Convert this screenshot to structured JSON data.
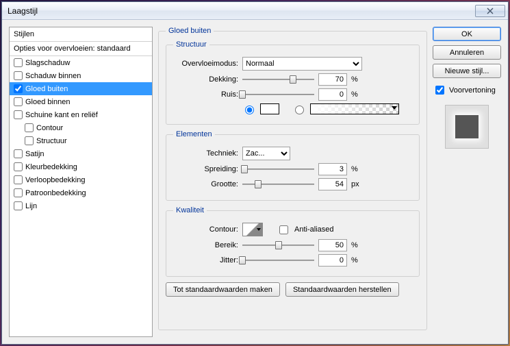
{
  "window": {
    "title": "Laagstijl"
  },
  "styles": {
    "header": "Stijlen",
    "blend": "Opties voor overvloeien: standaard",
    "items": [
      {
        "label": "Slagschaduw",
        "checked": false,
        "selected": false,
        "sub": false
      },
      {
        "label": "Schaduw binnen",
        "checked": false,
        "selected": false,
        "sub": false
      },
      {
        "label": "Gloed buiten",
        "checked": true,
        "selected": true,
        "sub": false
      },
      {
        "label": "Gloed binnen",
        "checked": false,
        "selected": false,
        "sub": false
      },
      {
        "label": "Schuine kant en reliëf",
        "checked": false,
        "selected": false,
        "sub": false
      },
      {
        "label": "Contour",
        "checked": false,
        "selected": false,
        "sub": true
      },
      {
        "label": "Structuur",
        "checked": false,
        "selected": false,
        "sub": true
      },
      {
        "label": "Satijn",
        "checked": false,
        "selected": false,
        "sub": false
      },
      {
        "label": "Kleurbedekking",
        "checked": false,
        "selected": false,
        "sub": false
      },
      {
        "label": "Verloopbedekking",
        "checked": false,
        "selected": false,
        "sub": false
      },
      {
        "label": "Patroonbedekking",
        "checked": false,
        "selected": false,
        "sub": false
      },
      {
        "label": "Lijn",
        "checked": false,
        "selected": false,
        "sub": false
      }
    ]
  },
  "panel": {
    "title": "Gloed buiten",
    "structure": {
      "legend": "Structuur",
      "blendmode_label": "Overvloeimodus:",
      "blendmode_value": "Normaal",
      "opacity_label": "Dekking:",
      "opacity_value": "70",
      "opacity_unit": "%",
      "noise_label": "Ruis:",
      "noise_value": "0",
      "noise_unit": "%"
    },
    "elements": {
      "legend": "Elementen",
      "technique_label": "Techniek:",
      "technique_value": "Zac...",
      "spread_label": "Spreiding:",
      "spread_value": "3",
      "spread_unit": "%",
      "size_label": "Grootte:",
      "size_value": "54",
      "size_unit": "px"
    },
    "quality": {
      "legend": "Kwaliteit",
      "contour_label": "Contour:",
      "antialias_label": "Anti-aliased",
      "range_label": "Bereik:",
      "range_value": "50",
      "range_unit": "%",
      "jitter_label": "Jitter:",
      "jitter_value": "0",
      "jitter_unit": "%"
    },
    "reset_btn": "Tot standaardwaarden maken",
    "restore_btn": "Standaardwaarden herstellen"
  },
  "right": {
    "ok": "OK",
    "cancel": "Annuleren",
    "newstyle": "Nieuwe stijl...",
    "preview": "Voorvertoning"
  }
}
